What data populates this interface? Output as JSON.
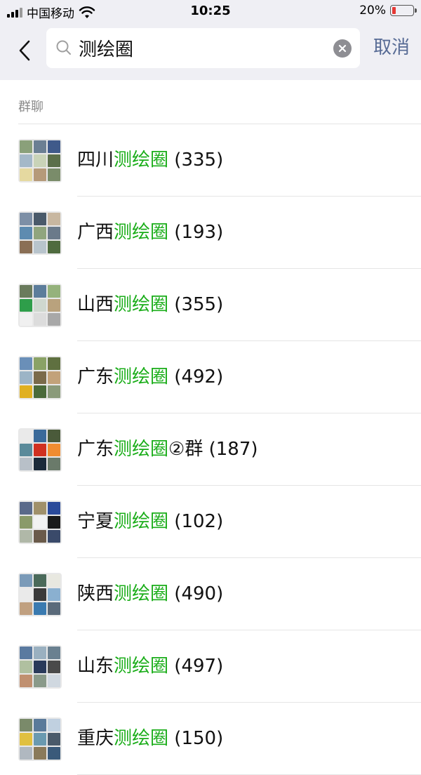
{
  "status_bar": {
    "carrier": "中国移动",
    "time": "10:25",
    "battery_percent": "20%",
    "battery_level": 0.2,
    "battery_color": "#e53935"
  },
  "search": {
    "query": "测绘圈",
    "back_icon": "chevron-left-icon",
    "search_icon": "search-icon",
    "clear_icon": "clear-icon",
    "cancel_label": "取消"
  },
  "section": {
    "header": "群聊"
  },
  "colors": {
    "highlight": "#1aad19",
    "link": "#576b95",
    "background": "#efeff4"
  },
  "results": [
    {
      "prefix": "四川",
      "match": "测绘圈",
      "suffix": " (335)",
      "avatar": [
        "#8aa07a",
        "#6b7f93",
        "#3f5a8a",
        "#a4b8c8",
        "#c9d3b8",
        "#5b6f4a",
        "#e5d9a0",
        "#b59a7a",
        "#7a8c6a"
      ]
    },
    {
      "prefix": "广西",
      "match": "测绘圈",
      "suffix": " (193)",
      "avatar": [
        "#7d8fa6",
        "#4a5a6a",
        "#c8b7a0",
        "#5d8bb0",
        "#90a57e",
        "#6b7a8a",
        "#8a6f55",
        "#b8c4cc",
        "#4f6b3f"
      ]
    },
    {
      "prefix": "山西",
      "match": "测绘圈",
      "suffix": " (355)",
      "avatar": [
        "#6a7b5c",
        "#5c7d9b",
        "#95b27c",
        "#2e9e4a",
        "#cfd8cf",
        "#b9a27d",
        "#f0f0f0",
        "#dcdcdc",
        "#a8a8a8"
      ]
    },
    {
      "prefix": "广东",
      "match": "测绘圈",
      "suffix": " (492)",
      "avatar": [
        "#6a8fb8",
        "#8aa266",
        "#5f7040",
        "#9cb4c6",
        "#7a6a4a",
        "#c2a27a",
        "#e0b020",
        "#4a6a3a",
        "#8a9a7a"
      ]
    },
    {
      "prefix": "广东",
      "match": "测绘圈",
      "suffix": "②群 (187)",
      "avatar": [
        "#eaeaea",
        "#3a6a9a",
        "#4a5a3a",
        "#5a8a9a",
        "#d03020",
        "#f08c30",
        "#b8c0c8",
        "#1a2a3a",
        "#6a7a6a"
      ]
    },
    {
      "prefix": "宁夏",
      "match": "测绘圈",
      "suffix": " (102)",
      "avatar": [
        "#5a6a8a",
        "#a0906a",
        "#2a4a9a",
        "#8a9a6a",
        "#f2f2f2",
        "#1a1a1a",
        "#b0b8a8",
        "#6a5a4a",
        "#3a4a6a"
      ]
    },
    {
      "prefix": "陕西",
      "match": "测绘圈",
      "suffix": " (490)",
      "avatar": [
        "#7a9ab8",
        "#4a6a5a",
        "#e8e8e0",
        "#eaeaea",
        "#3a3a3a",
        "#8ab0d0",
        "#c0a080",
        "#3a7ab0",
        "#5a6a7a"
      ]
    },
    {
      "prefix": "山东",
      "match": "测绘圈",
      "suffix": " (497)",
      "avatar": [
        "#5a7aa0",
        "#9ab0c0",
        "#6a8090",
        "#b0c0a0",
        "#2a3a5a",
        "#4a4a4a",
        "#c09070",
        "#8a9a8a",
        "#d0d8e0"
      ]
    },
    {
      "prefix": "重庆",
      "match": "测绘圈",
      "suffix": " (150)",
      "avatar": [
        "#7a8a6a",
        "#5a7a9a",
        "#c0d0e0",
        "#e0c040",
        "#6a9ab0",
        "#4a5a6a",
        "#b0b8c0",
        "#8a7a5a",
        "#3a5a7a"
      ]
    }
  ]
}
